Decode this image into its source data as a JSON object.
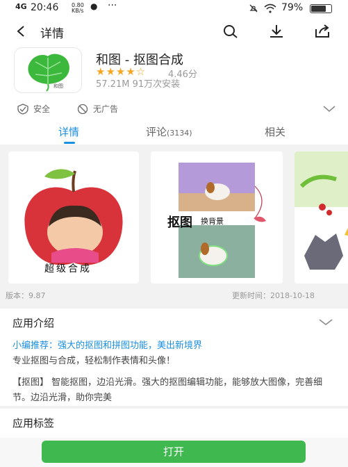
{
  "status_bar": {
    "network": "4G",
    "time": "20:46",
    "speed": "0.80 KB/s",
    "battery": "79%"
  },
  "header": {
    "title": "详情"
  },
  "app": {
    "name": "和图 - 抠图合成",
    "stars": "★★★★☆",
    "rating": "4.46分",
    "meta": "57.21M  91万次安装",
    "icon_text": "和图"
  },
  "badges": {
    "safe": "安全",
    "no_ads": "无广告"
  },
  "tabs": [
    {
      "label": "详情"
    },
    {
      "label": "评论",
      "count": "(3134)"
    },
    {
      "label": "相关"
    }
  ],
  "screenshots": {
    "shot1_text": "超级合成",
    "shot2_title": "抠图",
    "shot2_sub": "换背景"
  },
  "version": {
    "label": "版本：9.87",
    "updated": "更新时间：2018-10-18"
  },
  "intro": {
    "heading": "应用介绍",
    "recommend": "小编推荐：强大的抠图和拼图功能，美出新境界",
    "line1": "专业抠图与合成，轻松制作表情和头像！",
    "line2": "【抠图】 智能抠图，边沿光滑。强大的抠图编辑功能，能够放大图像，完善细节。边沿光滑，助你完美"
  },
  "tags": {
    "heading": "应用标签"
  },
  "actions": {
    "open": "打开"
  }
}
